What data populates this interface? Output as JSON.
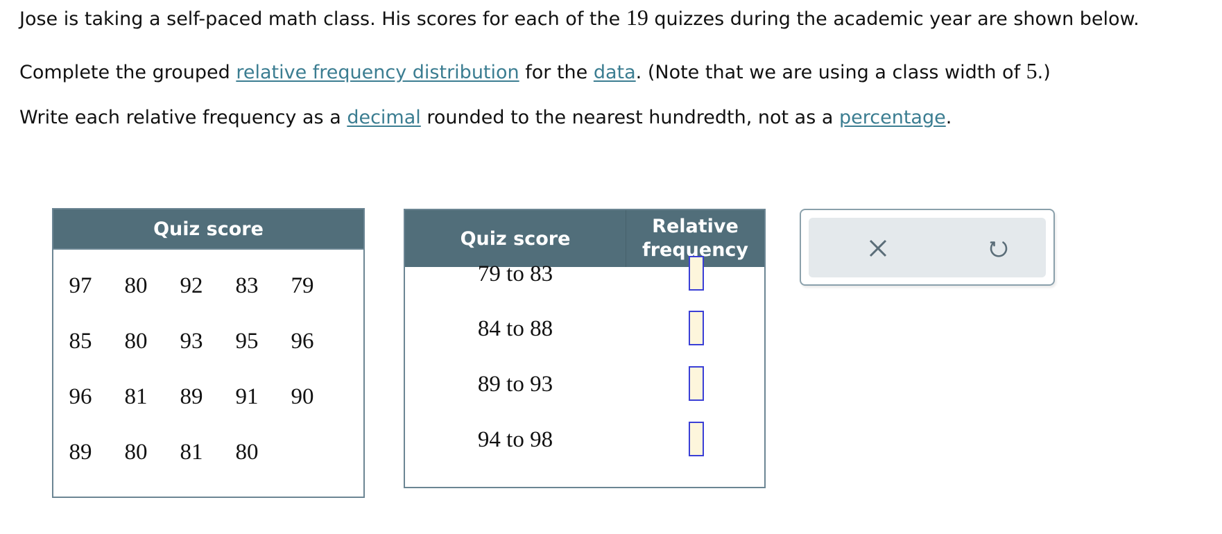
{
  "prompt": {
    "line1_a": "Jose is taking a self-paced math class. His scores for each of the ",
    "line1_n": "19",
    "line1_b": " quizzes during the academic year are shown below.",
    "line2_a": "Complete the grouped ",
    "line2_link1": "relative frequency distribution",
    "line2_b": " for the ",
    "line2_link2": "data",
    "line2_c": ". (Note that we are using a class width of ",
    "line2_n": "5",
    "line2_d": ".)",
    "line3_a": "Write each relative frequency as a ",
    "line3_link1": "decimal",
    "line3_b": " rounded to the nearest hundredth, not as a ",
    "line3_link2": "percentage",
    "line3_c": "."
  },
  "data_table": {
    "header": "Quiz score",
    "rows": [
      [
        "97",
        "80",
        "92",
        "83",
        "79"
      ],
      [
        "85",
        "80",
        "93",
        "95",
        "96"
      ],
      [
        "96",
        "81",
        "89",
        "91",
        "90"
      ],
      [
        "89",
        "80",
        "81",
        "80"
      ]
    ]
  },
  "freq_table": {
    "col1": "Quiz score",
    "col2": "Relative frequency",
    "rows": [
      {
        "label": "79 to 83",
        "value": ""
      },
      {
        "label": "84 to 88",
        "value": ""
      },
      {
        "label": "89 to 93",
        "value": ""
      },
      {
        "label": "94 to 98",
        "value": ""
      }
    ]
  },
  "tools": {
    "clear": "clear-icon",
    "undo": "undo-icon"
  }
}
